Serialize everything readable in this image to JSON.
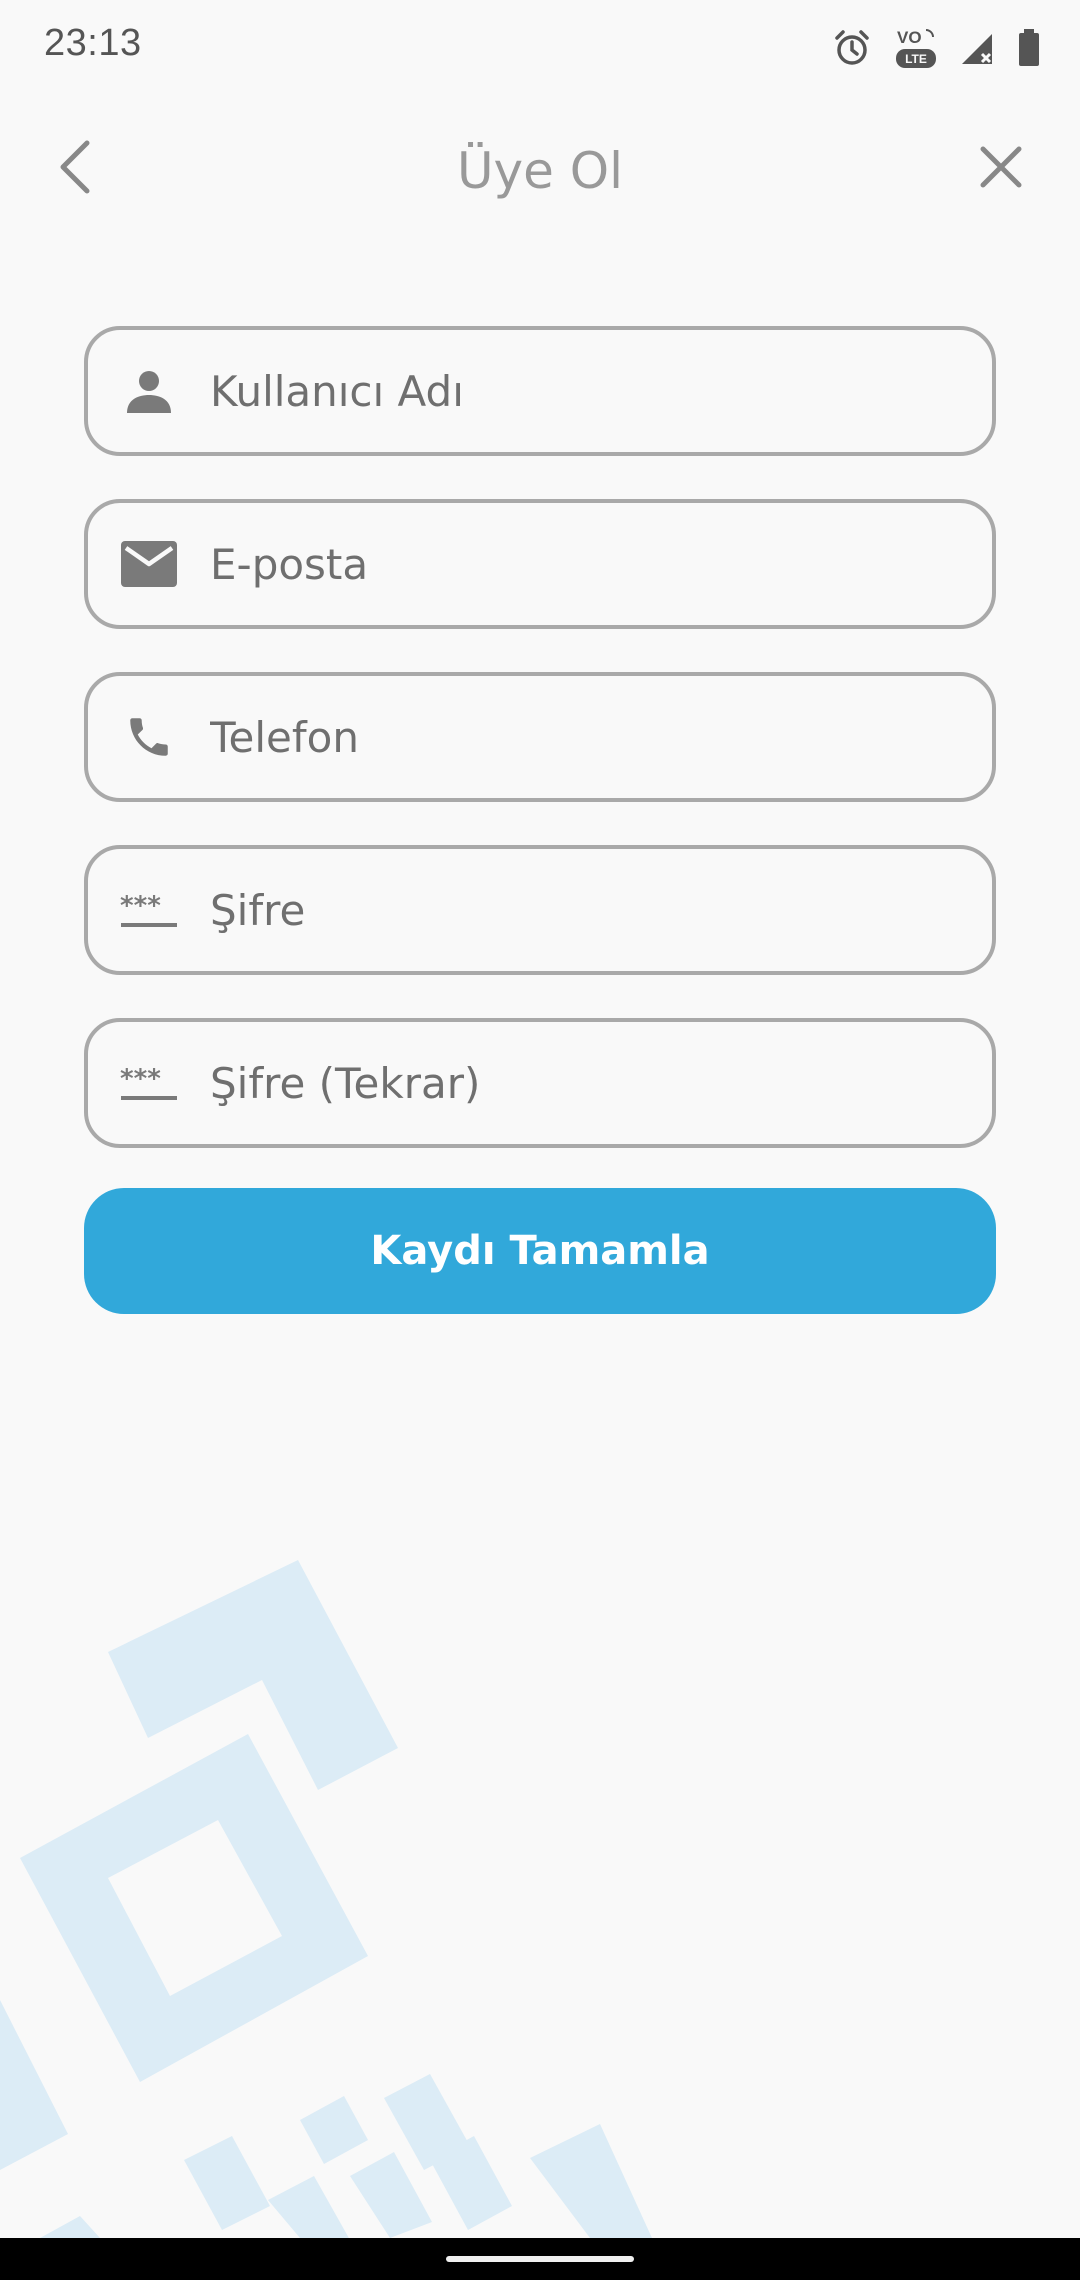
{
  "status_bar": {
    "time": "23:13",
    "icons": [
      "alarm-icon",
      "volte-lte-icon",
      "signal-icon",
      "battery-icon"
    ],
    "volte_label": "VO",
    "lte_label": "LTE"
  },
  "header": {
    "title": "Üye Ol",
    "back_icon": "chevron-left-icon",
    "close_icon": "close-icon"
  },
  "form": {
    "fields": [
      {
        "icon": "person-icon",
        "placeholder": "Kullanıcı Adı",
        "value": ""
      },
      {
        "icon": "mail-icon",
        "placeholder": "E-posta",
        "value": ""
      },
      {
        "icon": "phone-icon",
        "placeholder": "Telefon",
        "value": ""
      },
      {
        "icon": "password-icon",
        "placeholder": "Şifre",
        "value": ""
      },
      {
        "icon": "password-icon",
        "placeholder": "Şifre (Tekrar)",
        "value": ""
      }
    ],
    "submit_label": "Kaydı Tamamla"
  },
  "colors": {
    "accent": "#31a8da",
    "field_border": "#a9a9a9",
    "icon": "#7a7a7a",
    "title": "#999999",
    "background": "#f9f9f9",
    "decoration": "#dcecf6"
  }
}
